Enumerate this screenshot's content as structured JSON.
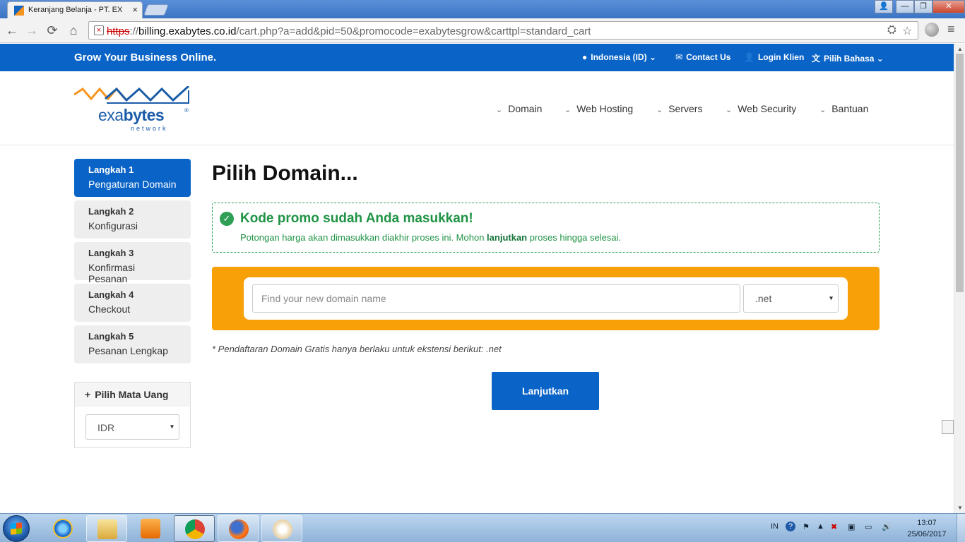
{
  "browser": {
    "tab_title": "Keranjang Belanja - PT. EX",
    "tab_close": "×",
    "url_scheme": "https",
    "url_sep": "://",
    "url_host": "billing.exabytes.co.id",
    "url_path": "/cart.php?a=add&pid=50&promocode=exabytesgrow&carttpl=standard_cart",
    "nav_back": "←",
    "nav_forward": "→",
    "nav_reload": "⟳",
    "nav_home": "⌂",
    "window_buttons": {
      "user": "👤",
      "minimize": "—",
      "restore": "❐",
      "close": "✕"
    },
    "translate": "⛭",
    "star": "☆",
    "menu": "≡"
  },
  "topbar": {
    "tagline": "Grow Your Business Online.",
    "country": "Indonesia (ID)",
    "contact": "Contact Us",
    "login": "Login Klien",
    "language": "Pilih Bahasa",
    "chev": "⌄"
  },
  "logo": {
    "text_a": "exa",
    "text_b": "bytes",
    "reg": "®",
    "sub": "network"
  },
  "mainnav": {
    "chev": "⌄",
    "items": [
      "Domain",
      "Web Hosting",
      "Servers",
      "Web Security",
      "Bantuan"
    ]
  },
  "steps": [
    {
      "num": "Langkah 1",
      "name": "Pengaturan Domain",
      "active": true
    },
    {
      "num": "Langkah 2",
      "name": "Konfigurasi",
      "active": false
    },
    {
      "num": "Langkah 3",
      "name": "Konfirmasi Pesanan",
      "active": false
    },
    {
      "num": "Langkah 4",
      "name": "Checkout",
      "active": false
    },
    {
      "num": "Langkah 5",
      "name": "Pesanan Lengkap",
      "active": false
    }
  ],
  "currency": {
    "title": "Pilih Mata Uang",
    "plus": "+",
    "selected": "IDR",
    "caret": "▾"
  },
  "main": {
    "title": "Pilih Domain...",
    "promo_check": "✓",
    "promo_title": "Kode promo sudah Anda masukkan!",
    "promo_text_before": "Potongan harga akan dimasukkan diakhir proses ini. Mohon ",
    "promo_text_bold": "lanjutkan",
    "promo_text_after": " proses hingga selesai.",
    "search_placeholder": "Find your new domain name",
    "tld_selected": ".net",
    "caret": "▾",
    "note": "* Pendaftaran Domain Gratis hanya berlaku untuk ekstensi berikut: .net",
    "continue_label": "Lanjutkan"
  },
  "scrollbar": {
    "up": "▲",
    "down": "▼"
  },
  "taskbar": {
    "lang": "IN",
    "help": "?",
    "clock_time": "13:07",
    "clock_date": "25/06/2017"
  },
  "colors": {
    "primary": "#0a63c6",
    "accent_orange": "#f7a007",
    "success_green": "#1f9345"
  }
}
